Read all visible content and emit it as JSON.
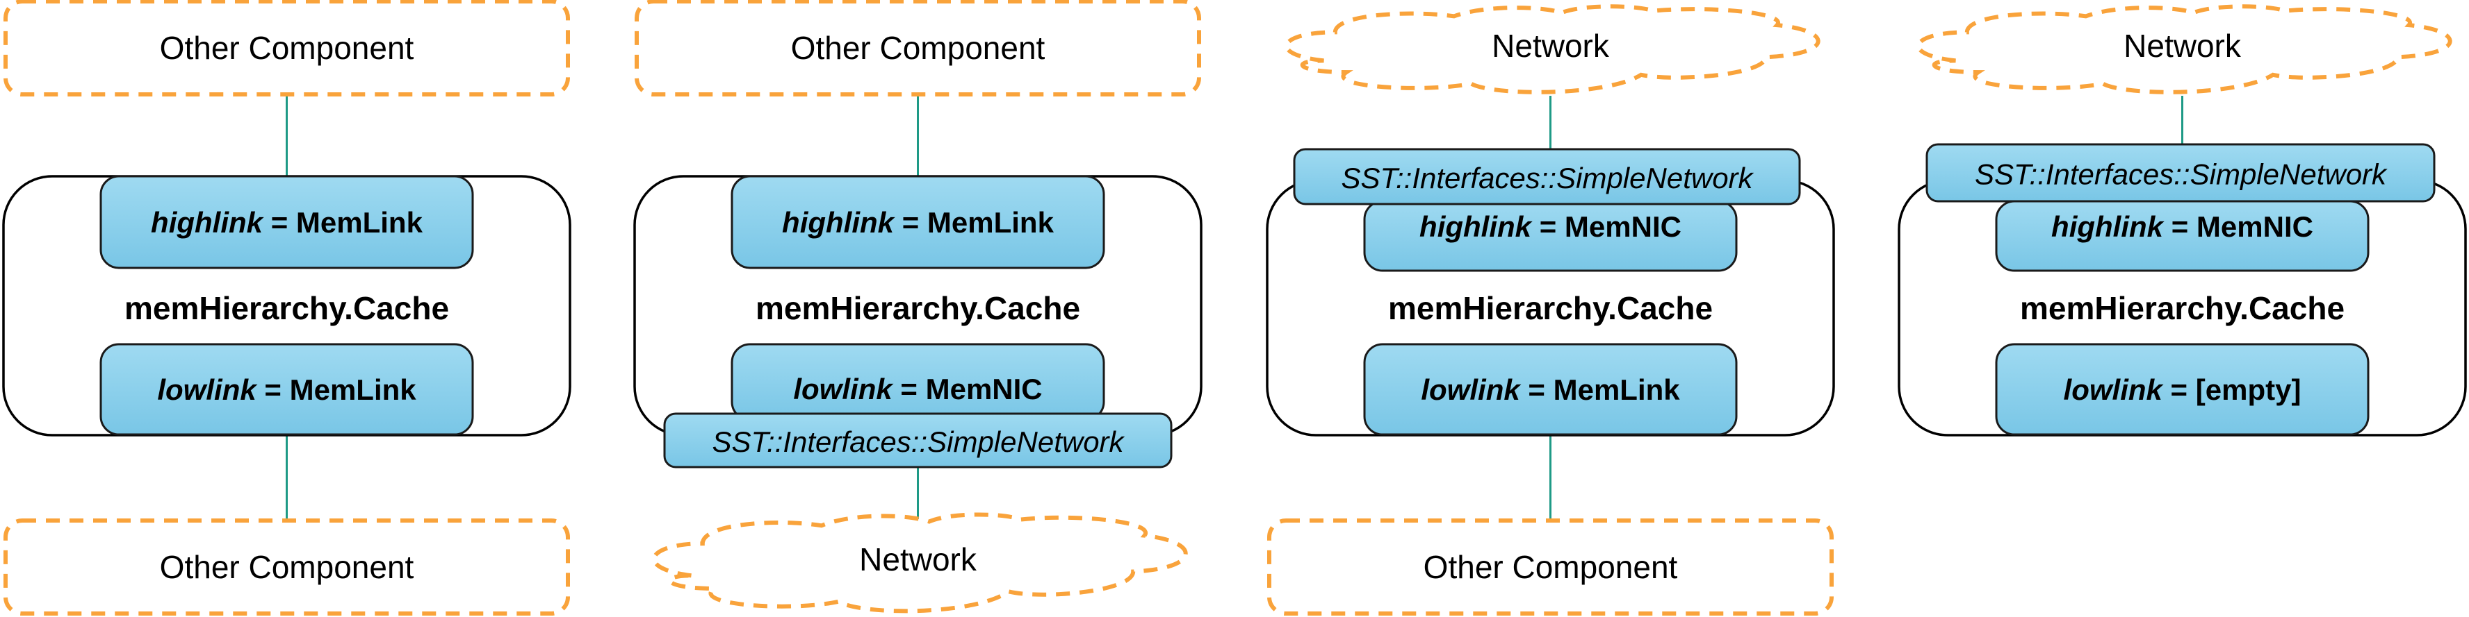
{
  "diagram": {
    "colors": {
      "external_border": "#F9A33B",
      "wire": "#1E9A86",
      "port_fill_top": "#9FDAF1",
      "port_fill_bottom": "#79C6E6",
      "component_border": "#000000"
    },
    "panels": [
      {
        "top": {
          "shape": "rounded-rect",
          "label": "Other Component"
        },
        "component": "memHierarchy.Cache",
        "highlink": {
          "name": "highlink",
          "value": "MemLink"
        },
        "lowlink": {
          "name": "lowlink",
          "value": "MemLink"
        },
        "interface": null,
        "bottom": {
          "shape": "rounded-rect",
          "label": "Other Component"
        }
      },
      {
        "top": {
          "shape": "rounded-rect",
          "label": "Other Component"
        },
        "component": "memHierarchy.Cache",
        "highlink": {
          "name": "highlink",
          "value": "MemLink"
        },
        "lowlink": {
          "name": "lowlink",
          "value": "MemNIC"
        },
        "interface": {
          "position": "bottom",
          "label": "SST::Interfaces::SimpleNetwork"
        },
        "bottom": {
          "shape": "cloud",
          "label": "Network"
        }
      },
      {
        "top": {
          "shape": "cloud",
          "label": "Network"
        },
        "component": "memHierarchy.Cache",
        "highlink": {
          "name": "highlink",
          "value": "MemNIC"
        },
        "lowlink": {
          "name": "lowlink",
          "value": "MemLink"
        },
        "interface": {
          "position": "top",
          "label": "SST::Interfaces::SimpleNetwork"
        },
        "bottom": {
          "shape": "rounded-rect",
          "label": "Other Component"
        }
      },
      {
        "top": {
          "shape": "cloud",
          "label": "Network"
        },
        "component": "memHierarchy.Cache",
        "highlink": {
          "name": "highlink",
          "value": "MemNIC"
        },
        "lowlink": {
          "name": "lowlink",
          "value": "[empty]"
        },
        "interface": {
          "position": "top",
          "label": "SST::Interfaces::SimpleNetwork"
        },
        "bottom": null
      }
    ],
    "equals": "="
  }
}
